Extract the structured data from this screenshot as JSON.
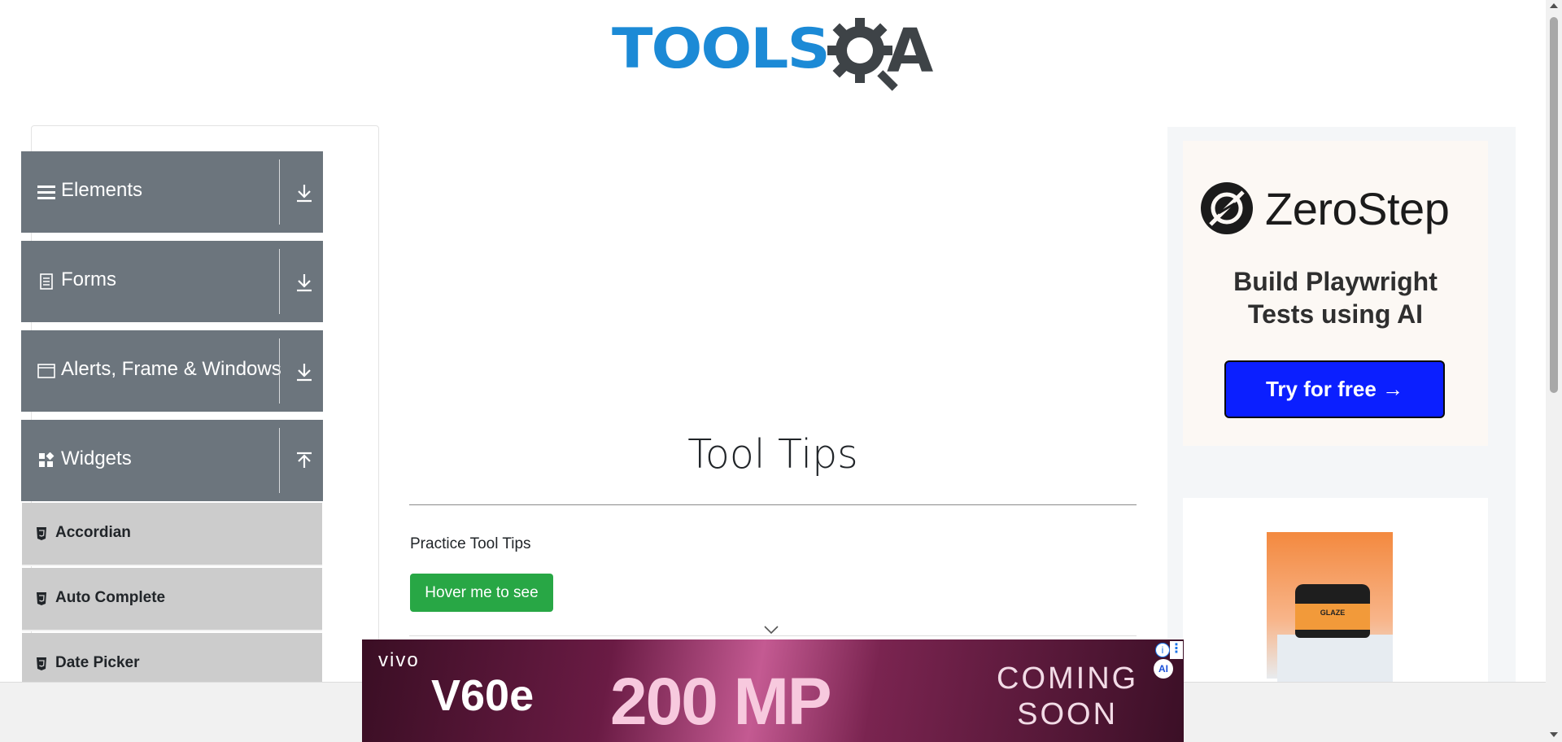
{
  "header": {
    "logo_tools": "TOOLS",
    "logo_qa": "A",
    "logo_color": "#1c8ad6"
  },
  "sidebar": {
    "groups": [
      {
        "label": "Elements",
        "icon": "menu-lines-icon",
        "state": "collapsed"
      },
      {
        "label": "Forms",
        "icon": "document-icon",
        "state": "collapsed"
      },
      {
        "label": "Alerts, Frame & Windows",
        "icon": "window-icon",
        "state": "collapsed"
      },
      {
        "label": "Widgets",
        "icon": "widgets-icon",
        "state": "expanded"
      }
    ],
    "widget_items": [
      {
        "label": "Accordian",
        "icon": "html5-icon"
      },
      {
        "label": "Auto Complete",
        "icon": "html5-icon"
      },
      {
        "label": "Date Picker",
        "icon": "html5-icon"
      }
    ]
  },
  "main": {
    "title": "Tool Tips",
    "subtitle": "Practice Tool Tips",
    "hover_button": "Hover me to see"
  },
  "right_ad": {
    "brand": "ZeroStep",
    "tagline_line1": "Build Playwright",
    "tagline_line2": "Tests using AI",
    "cta": "Try for free →",
    "product_label": "GLAZE",
    "cta_color": "#0b1fff"
  },
  "bottom_ad": {
    "brand": "vivo",
    "model": "V60e",
    "megapixels": "200 MP",
    "coming_line1": "COMING",
    "coming_line2": "SOON",
    "ai_badge": "AI"
  },
  "colors": {
    "sidebar_group_bg": "#6c757d",
    "sidebar_item_bg": "#cccccc",
    "button_green": "#28a745"
  }
}
